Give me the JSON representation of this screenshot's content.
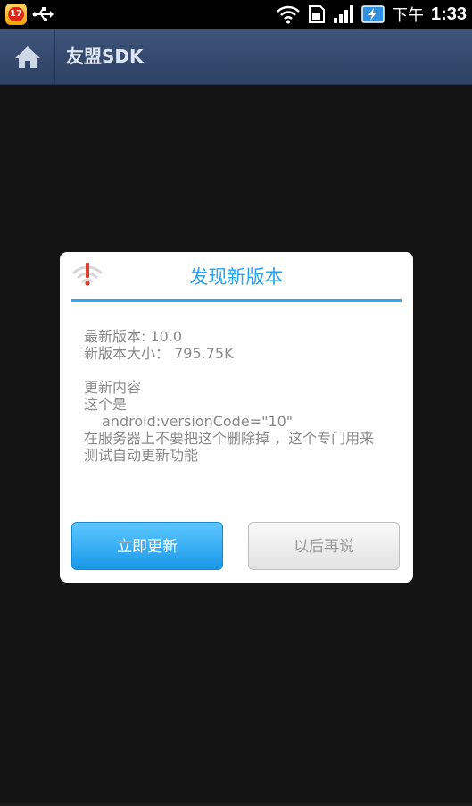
{
  "status_bar": {
    "notification_count": "17",
    "ampm": "下午",
    "time": "1:33"
  },
  "action_bar": {
    "title": "友盟SDK"
  },
  "dialog": {
    "title": "发现新版本",
    "latest_version": "最新版本: 10.0",
    "size": "新版本大小： 795.75K",
    "changelog_header": "更新内容",
    "changelog_line1": "这个是",
    "changelog_line2": "android:versionCode=\"10\"",
    "changelog_line3": "在服务器上不要把这个删除掉 ，这个专门用来",
    "changelog_line4": "测试自动更新功能",
    "update_now_label": "立即更新",
    "later_label": "以后再说"
  },
  "colors": {
    "accent": "#2aa3f0",
    "action_bar": "#33486d",
    "background": "#141414"
  }
}
